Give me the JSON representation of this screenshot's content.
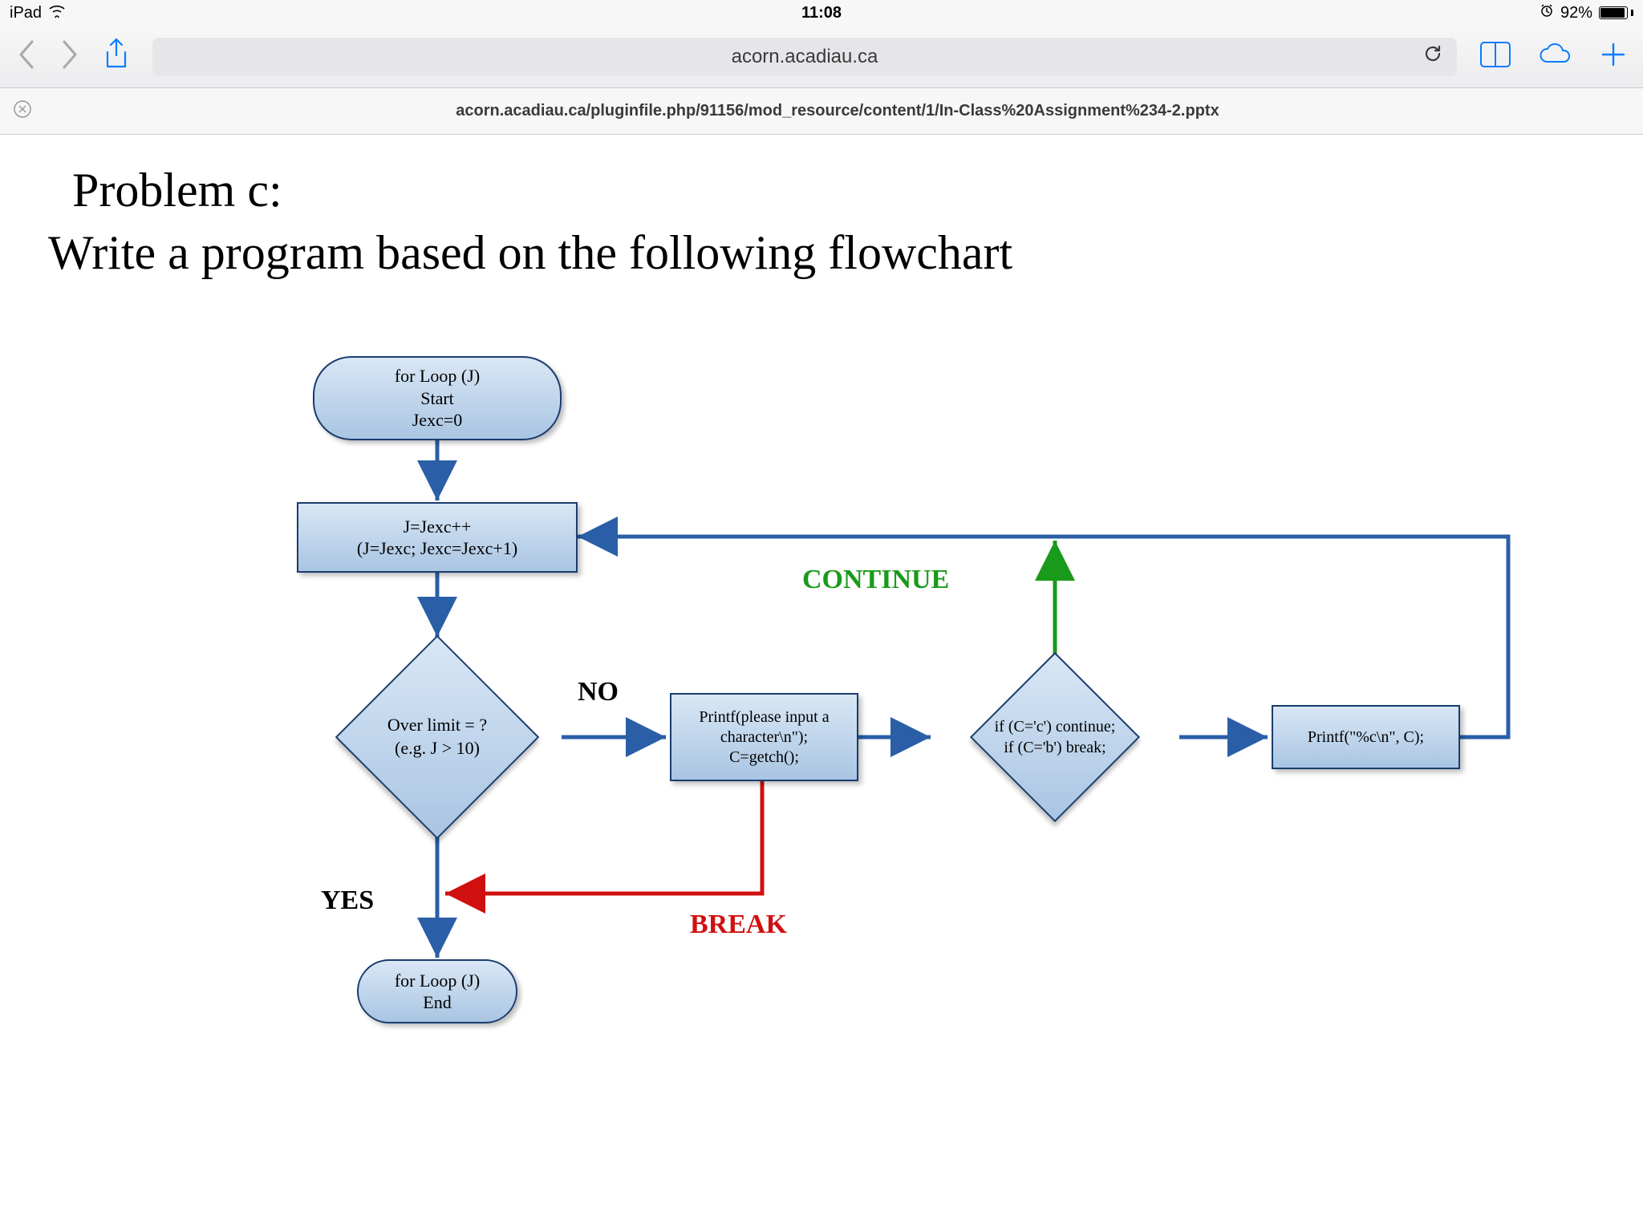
{
  "statusbar": {
    "device": "iPad",
    "time": "11:08",
    "battery_pct": "92%"
  },
  "toolbar": {
    "address": "acorn.acadiau.ca"
  },
  "url_line": {
    "full_url": "acorn.acadiau.ca/pluginfile.php/91156/mod_resource/content/1/In-Class%20Assignment%234-2.pptx"
  },
  "heading": {
    "line1": "Problem c:",
    "line2": "Write a program based on the following flowchart"
  },
  "flow": {
    "start": {
      "l1": "for Loop (J)",
      "l2": "Start",
      "l3": "Jexc=0"
    },
    "increment": {
      "l1": "J=Jexc++",
      "l2": "(J=Jexc;  Jexc=Jexc+1)"
    },
    "decision1": {
      "l1": "Over limit  = ?",
      "l2": "(e.g. J > 10)"
    },
    "process_input": {
      "l1": "Printf(please input a",
      "l2": "character\\n\");",
      "l3": "C=getch();"
    },
    "decision2": {
      "l1": "if (C='c') continue;",
      "l2": "if (C='b') break;"
    },
    "process_print": {
      "l1": "Printf(\"%c\\n\", C);"
    },
    "end": {
      "l1": "for Loop (J)",
      "l2": "End"
    },
    "labels": {
      "no": "NO",
      "yes": "YES",
      "cont": "CONTINUE",
      "brk": "BREAK"
    }
  }
}
